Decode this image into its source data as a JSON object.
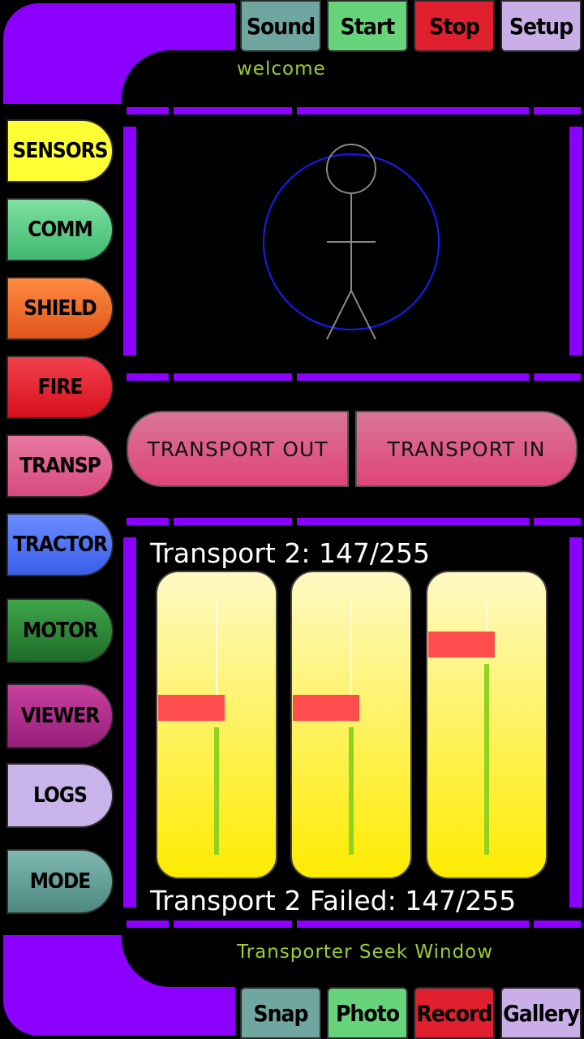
{
  "top_buttons": [
    {
      "label": "Sound",
      "color": "#6fa6a0"
    },
    {
      "label": "Start",
      "color": "#67d37a"
    },
    {
      "label": "Stop",
      "color": "#e0202e"
    },
    {
      "label": "Setup",
      "color": "#c9aee8"
    }
  ],
  "header_label": "welcome",
  "side_buttons": [
    {
      "label": "SENSORS",
      "color": "#ffff33"
    },
    {
      "label": "COMM",
      "color": "#5fd08a"
    },
    {
      "label": "SHIELD",
      "color": "#f26b22"
    },
    {
      "label": "FIRE",
      "color": "#e21d30"
    },
    {
      "label": "TRANSP",
      "color": "#e0568a"
    },
    {
      "label": "TRACTOR",
      "color": "#4e74f5"
    },
    {
      "label": "MOTOR",
      "color": "#2e8a3a"
    },
    {
      "label": "VIEWER",
      "color": "#b02a8a"
    },
    {
      "label": "LOGS",
      "color": "#c8b4ea"
    },
    {
      "label": "MODE",
      "color": "#6fa69e"
    }
  ],
  "transport_out": "TRANSPORT OUT",
  "transport_in": "TRANSPORT IN",
  "status_top": "Transport 2: 147/255",
  "status_bottom": "Transport 2 Failed: 147/255",
  "sliders": [
    {
      "value": 147,
      "max": 255
    },
    {
      "value": 147,
      "max": 255
    },
    {
      "value": 210,
      "max": 255
    }
  ],
  "footer_label": "Transporter Seek Window",
  "bottom_buttons": [
    {
      "label": "Snap",
      "color": "#6fa6a0"
    },
    {
      "label": "Photo",
      "color": "#67d37a"
    },
    {
      "label": "Record",
      "color": "#e0202e"
    },
    {
      "label": "Gallery",
      "color": "#c9aee8"
    }
  ],
  "accent": "#8b00ff"
}
